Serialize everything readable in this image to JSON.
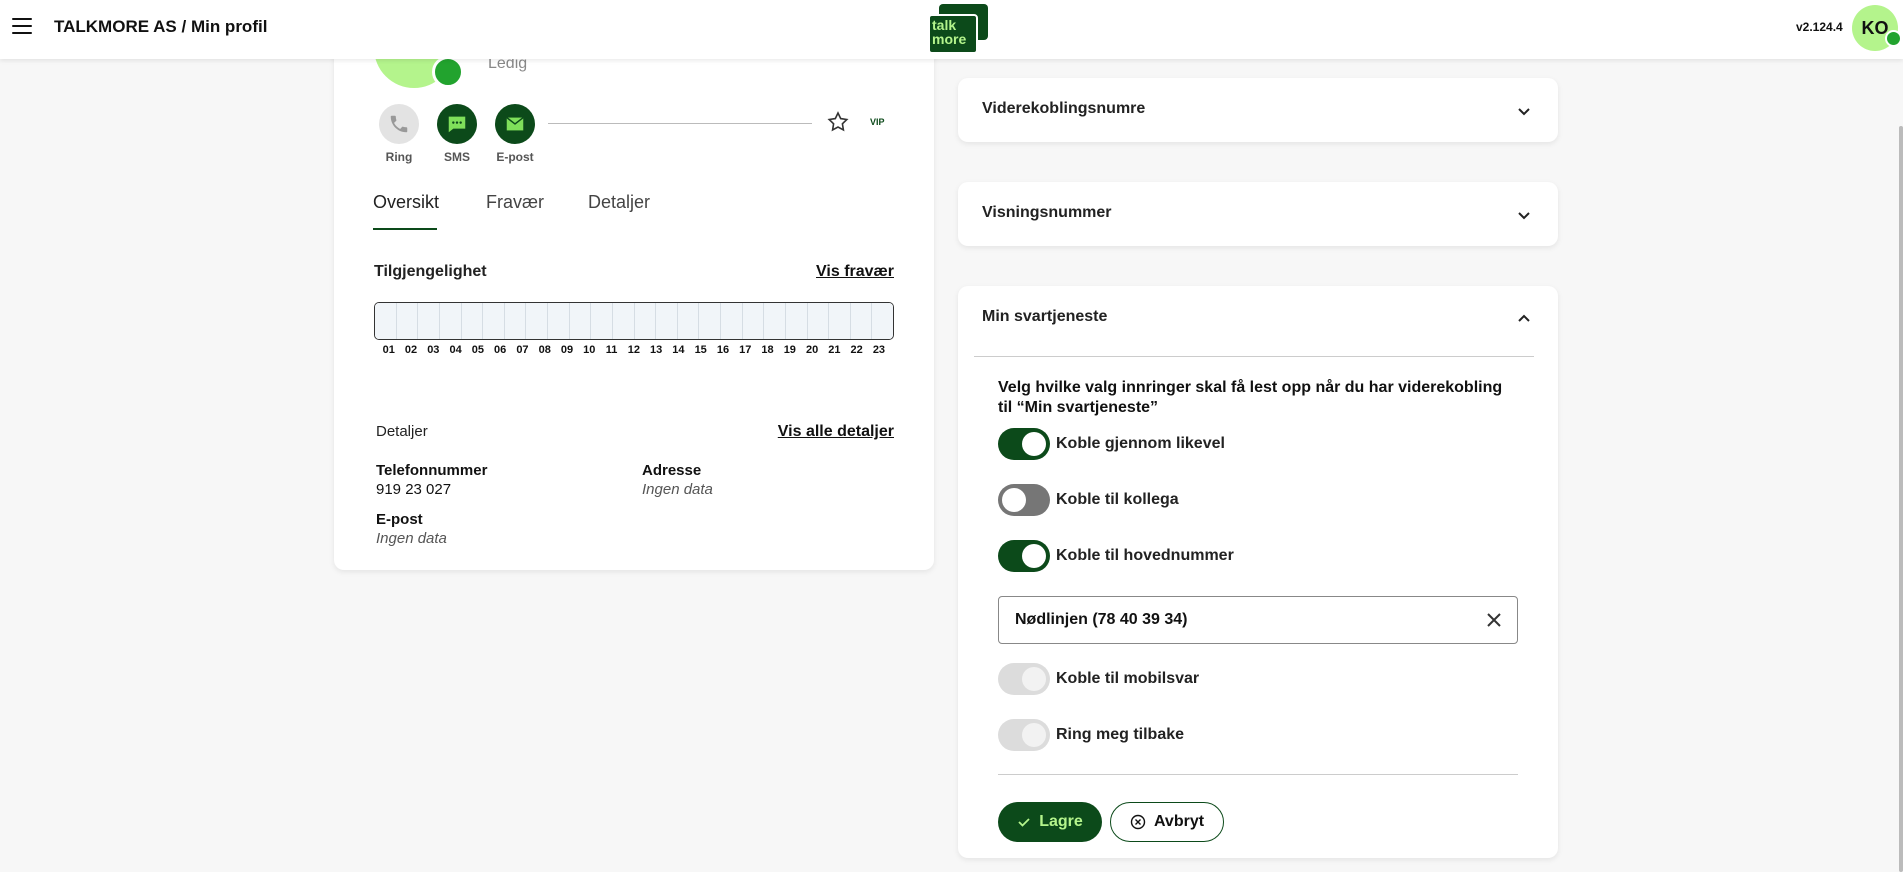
{
  "header": {
    "breadcrumb": "TALKMORE AS / Min profil",
    "logo_line1": "talk",
    "logo_line2": "more",
    "version": "v2.124.4",
    "avatar_initials": "KO"
  },
  "profile": {
    "status": "Ledig",
    "actions": {
      "ring": "Ring",
      "sms": "SMS",
      "mail": "E-post"
    },
    "vip": "VIP",
    "tabs": [
      "Oversikt",
      "Fravær",
      "Detaljer"
    ],
    "availability": {
      "title": "Tilgjengelighet",
      "link": "Vis fravær",
      "hours": [
        "01",
        "02",
        "03",
        "04",
        "05",
        "06",
        "07",
        "08",
        "09",
        "10",
        "11",
        "12",
        "13",
        "14",
        "15",
        "16",
        "17",
        "18",
        "19",
        "20",
        "21",
        "22",
        "23"
      ]
    },
    "details": {
      "title": "Detaljer",
      "link": "Vis alle detaljer",
      "phone_label": "Telefonnummer",
      "phone_value": "919 23 027",
      "address_label": "Adresse",
      "address_value": "Ingen data",
      "email_label": "E-post",
      "email_value": "Ingen data"
    }
  },
  "accordions": {
    "forward": "Viderekoblingsnumre",
    "display": "Visningsnummer",
    "voicemail": {
      "title": "Min svartjeneste",
      "intro": "Velg hvilke valg innringer skal få lest opp når du har viderekobling til “Min svartjeneste”",
      "toggles": [
        {
          "label": "Koble gjennom likevel",
          "state": "on"
        },
        {
          "label": "Koble til kollega",
          "state": "off"
        },
        {
          "label": "Koble til hovednummer",
          "state": "on"
        },
        {
          "label": "Koble til mobilsvar",
          "state": "disabled"
        },
        {
          "label": "Ring meg tilbake",
          "state": "disabled"
        }
      ],
      "selected_number": "Nødlinjen (78 40 39 34)",
      "save": "Lagre",
      "cancel": "Avbryt"
    }
  },
  "colors": {
    "brand_dark": "#0c4a1a",
    "brand_light": "#b4f48c",
    "status_green": "#22a32e"
  }
}
